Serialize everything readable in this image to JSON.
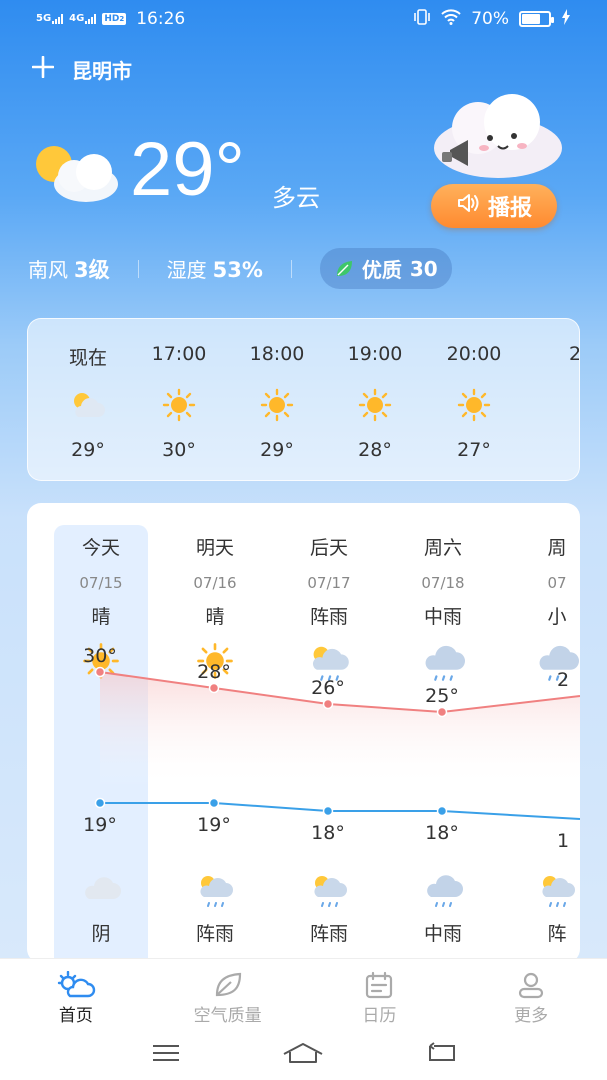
{
  "status_bar": {
    "network1": "5G",
    "network2": "4G",
    "hd": "HD",
    "hd_sub": "2",
    "time": "16:26",
    "battery": "70%",
    "battery_level": 0.7
  },
  "header": {
    "city": "昆明市"
  },
  "current": {
    "temp": "29°",
    "desc": "多云",
    "wind_label": "南风",
    "wind_value": "3级",
    "humidity_label": "湿度",
    "humidity_value": "53%",
    "aqi_label": "优质",
    "aqi_value": "30",
    "broadcast_label": "播报"
  },
  "hourly": [
    {
      "time": "现在",
      "icon": "partly-cloudy-icon",
      "temp": "29°"
    },
    {
      "time": "17:00",
      "icon": "sun-icon",
      "temp": "30°"
    },
    {
      "time": "18:00",
      "icon": "sun-icon",
      "temp": "29°"
    },
    {
      "time": "19:00",
      "icon": "sun-icon",
      "temp": "28°"
    },
    {
      "time": "20:00",
      "icon": "sun-icon",
      "temp": "27°"
    },
    {
      "time": "2",
      "icon": "",
      "temp": ""
    }
  ],
  "daily": [
    {
      "name": "今天",
      "date": "07/15",
      "day_weather": "晴",
      "day_icon": "sun-icon",
      "high": 30,
      "high_label": "30°",
      "low": 19,
      "low_label": "19°",
      "night_icon": "cloud-icon",
      "night_weather": "阴"
    },
    {
      "name": "明天",
      "date": "07/16",
      "day_weather": "晴",
      "day_icon": "sun-icon",
      "high": 28,
      "high_label": "28°",
      "low": 19,
      "low_label": "19°",
      "night_icon": "shower-icon",
      "night_weather": "阵雨"
    },
    {
      "name": "后天",
      "date": "07/17",
      "day_weather": "阵雨",
      "day_icon": "shower-icon",
      "high": 26,
      "high_label": "26°",
      "low": 18,
      "low_label": "18°",
      "night_icon": "shower-icon",
      "night_weather": "阵雨"
    },
    {
      "name": "周六",
      "date": "07/18",
      "day_weather": "中雨",
      "day_icon": "rain-icon",
      "high": 25,
      "high_label": "25°",
      "low": 18,
      "low_label": "18°",
      "night_icon": "rain-icon",
      "night_weather": "中雨"
    },
    {
      "name": "周",
      "date": "07",
      "day_weather": "小",
      "day_icon": "rain-icon",
      "high": 27,
      "high_label": "2",
      "low": 17,
      "low_label": "1",
      "night_icon": "shower-icon",
      "night_weather": "阵"
    }
  ],
  "tabs": [
    {
      "label": "首页",
      "icon": "home-weather-icon"
    },
    {
      "label": "空气质量",
      "icon": "leaf-icon"
    },
    {
      "label": "日历",
      "icon": "calendar-icon"
    },
    {
      "label": "更多",
      "icon": "person-icon"
    }
  ],
  "colors": {
    "high_line": "#f08080",
    "low_line": "#3aa0e8",
    "broadcast": "#ff9a3c",
    "accent": "#2f8cf0"
  }
}
